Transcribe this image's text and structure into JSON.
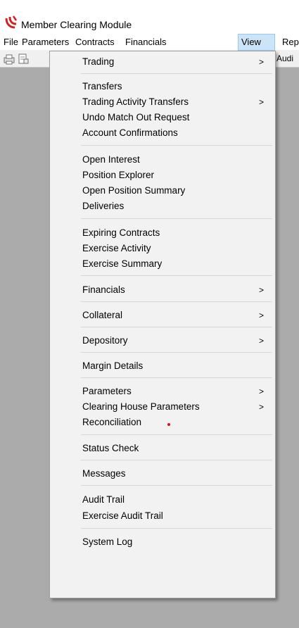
{
  "window": {
    "title": "Member Clearing Module",
    "accent_color": "#d42020"
  },
  "menubar": {
    "items": [
      {
        "label": "File"
      },
      {
        "label": "Parameters"
      },
      {
        "label": "Contracts"
      },
      {
        "label": "Financials"
      },
      {
        "label": "View"
      },
      {
        "label": "Rep"
      }
    ],
    "active": "View"
  },
  "toolbar": {
    "icons": [
      "print-icon",
      "page-setup-icon"
    ],
    "tail_label": "Audi"
  },
  "view_menu": {
    "items": [
      {
        "label": "Trading",
        "submenu": true
      },
      {
        "label": "Transfers",
        "submenu": false
      },
      {
        "label": "Trading Activity Transfers",
        "submenu": true
      },
      {
        "label": "Undo Match Out Request",
        "submenu": false
      },
      {
        "label": "Account Confirmations",
        "submenu": false
      },
      {
        "label": "Open Interest",
        "submenu": false
      },
      {
        "label": "Position Explorer",
        "submenu": false
      },
      {
        "label": "Open Position Summary",
        "submenu": false
      },
      {
        "label": "Deliveries",
        "submenu": false
      },
      {
        "label": "Expiring Contracts",
        "submenu": false
      },
      {
        "label": "Exercise Activity",
        "submenu": false
      },
      {
        "label": "Exercise Summary",
        "submenu": false
      },
      {
        "label": "Financials",
        "submenu": true
      },
      {
        "label": "Collateral",
        "submenu": true
      },
      {
        "label": "Depository",
        "submenu": true
      },
      {
        "label": "Margin Details",
        "submenu": false
      },
      {
        "label": "Parameters",
        "submenu": true
      },
      {
        "label": "Clearing House Parameters",
        "submenu": true
      },
      {
        "label": "Reconciliation",
        "submenu": false
      },
      {
        "label": "Status Check",
        "submenu": false
      },
      {
        "label": "Messages",
        "submenu": false
      },
      {
        "label": "Audit Trail",
        "submenu": false
      },
      {
        "label": "Exercise Audit Trail",
        "submenu": false
      },
      {
        "label": "System Log",
        "submenu": false
      }
    ],
    "submenu_arrow": ">"
  }
}
